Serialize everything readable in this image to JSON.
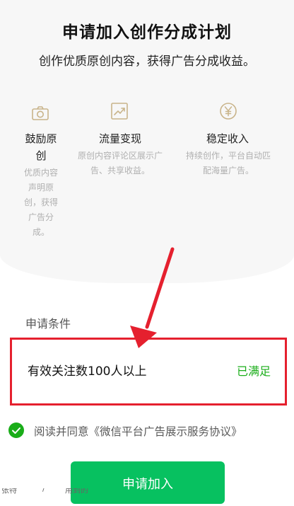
{
  "header": {
    "title": "申请加入创作分成计划",
    "subtitle": "创作优质原创内容，获得广告分成收益。"
  },
  "features": [
    {
      "icon": "camera-icon",
      "title_lines": [
        "鼓励原",
        "创"
      ],
      "desc_lines": [
        "优质内容",
        "声明原",
        "创，获得",
        "广告分",
        "成。"
      ]
    },
    {
      "icon": "trend-chart-icon",
      "title_lines": [
        "流量变现"
      ],
      "desc_lines": [
        "原创内容评论区展示广",
        "告、共享收益。"
      ]
    },
    {
      "icon": "yen-coin-icon",
      "title_lines": [
        "稳定收入"
      ],
      "desc_lines": [
        "持续创作，平台自动匹",
        "配海量广告。"
      ]
    }
  ],
  "conditions": {
    "label": "申请条件",
    "item_text": "有效关注数100人以上",
    "item_status": "已满足"
  },
  "agreement": {
    "text": "阅读并同意《微信平台广告展示服务协议》"
  },
  "apply_button": {
    "label": "申请加入"
  },
  "bottom_strip": {
    "left_text": "张特",
    "mid_text": "/",
    "right_text": "用到的"
  },
  "colors": {
    "accent_green": "#07c160",
    "status_green": "#1aad19",
    "annotation_red": "#e5202e"
  }
}
